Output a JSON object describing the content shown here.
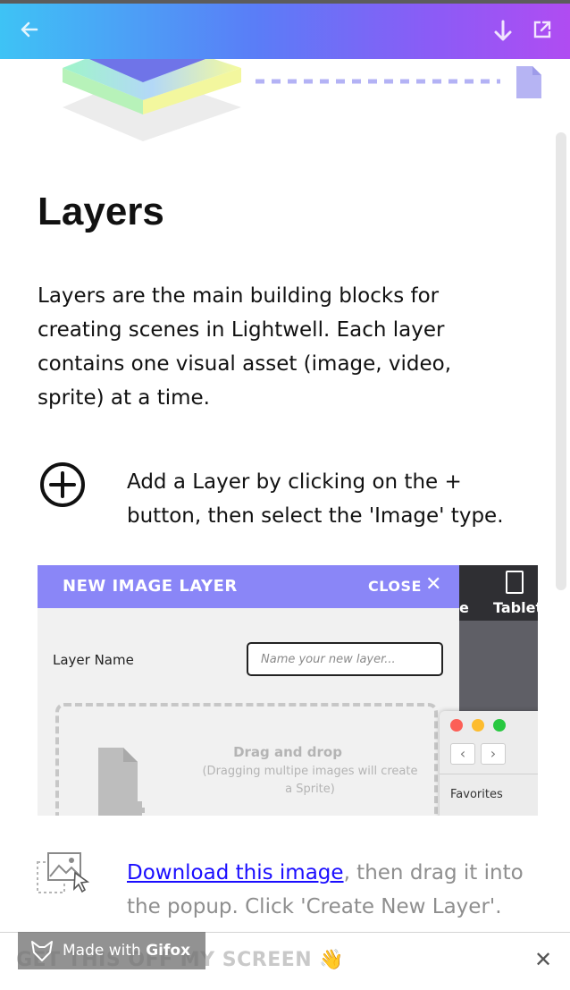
{
  "toolbar": {
    "back_icon": "arrow-left-icon",
    "download_icon": "download-arrow-icon",
    "external_icon": "external-link-icon"
  },
  "hero": {
    "illustration": "layers-stack-icon",
    "document_icon": "document-icon"
  },
  "article": {
    "title": "Layers",
    "intro": "Layers are the main building blocks for creating scenes in Lightwell. Each layer contains one visual asset (image, video, sprite) at a time.",
    "step1_icon": "plus-circle-icon",
    "step1_text": "Add a Layer by clicking on the + button, then select the 'Image' type.",
    "step2_icon": "image-drag-icon",
    "step2_link": "Download this image",
    "step2_text": ", then drag it into the popup. Click 'Create New Layer'."
  },
  "screenshot": {
    "panel_title": "NEW IMAGE LAYER",
    "close_label": "CLOSE",
    "close_glyph": "✕",
    "partial_label": "e",
    "tablet_label": "Tablet",
    "layer_name_label": "Layer Name",
    "layer_name_placeholder": "Name your new layer...",
    "drop_title": "Drag and drop",
    "drop_subtitle": "(Dragging multipe images will create a Sprite)",
    "finder_favorites": "Favorites",
    "finder_back": "‹",
    "finder_forward": "›"
  },
  "footer": {
    "dismiss_text": "GET THIS OFF MY SCREEN 👋",
    "close_glyph": "✕"
  },
  "watermark": {
    "made_with": "Made with ",
    "brand": "Gifox"
  },
  "colors": {
    "header_gradient_start": "#3ec3f5",
    "header_gradient_end": "#b04cf2",
    "panel_header": "#8a86f7",
    "link": "#1a0dff"
  }
}
